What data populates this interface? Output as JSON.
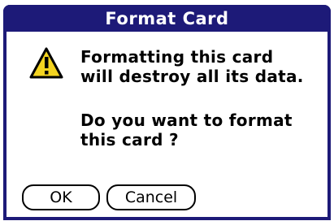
{
  "dialog": {
    "title": "Format Card",
    "icon": "warning-icon",
    "message_lines": [
      "Formatting this card",
      "will destroy all its data."
    ],
    "question_lines": [
      "Do you want to format",
      "this card ?"
    ],
    "buttons": {
      "ok": "OK",
      "cancel": "Cancel"
    }
  },
  "colors": {
    "title_bar": "#1d1a78",
    "title_text": "#ffffff",
    "warning_fill": "#f3d320"
  }
}
